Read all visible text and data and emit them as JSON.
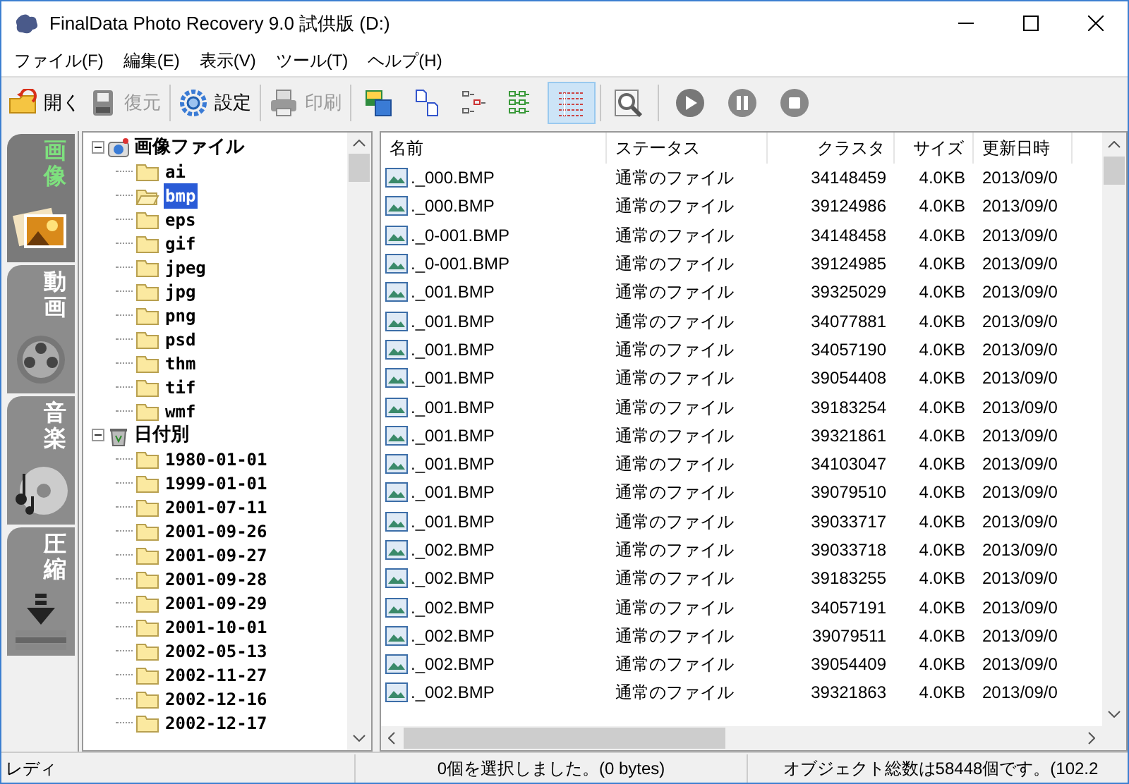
{
  "window": {
    "title": "FinalData Photo Recovery 9.0 試供版 (D:)"
  },
  "menu": [
    "ファイル(F)",
    "編集(E)",
    "表示(V)",
    "ツール(T)",
    "ヘルプ(H)"
  ],
  "toolbar_groups": [
    [
      {
        "kind": "text",
        "label": "開く",
        "disabled": false
      },
      {
        "kind": "text",
        "label": "復元",
        "disabled": true
      }
    ],
    [
      {
        "kind": "text",
        "label": "設定",
        "disabled": false
      }
    ],
    [
      {
        "kind": "text",
        "label": "印刷",
        "disabled": true
      }
    ],
    [
      {
        "kind": "icon",
        "selected": false
      },
      {
        "kind": "icon",
        "selected": false
      },
      {
        "kind": "icon",
        "selected": false
      },
      {
        "kind": "icon",
        "selected": false
      },
      {
        "kind": "icon",
        "selected": true
      }
    ],
    [
      {
        "kind": "icon",
        "selected": false
      }
    ],
    [
      {
        "kind": "media",
        "selected": false
      },
      {
        "kind": "media",
        "selected": false
      },
      {
        "kind": "media",
        "selected": false
      }
    ]
  ],
  "categories": [
    {
      "label": "画像",
      "selected": true
    },
    {
      "label": "動画",
      "selected": false
    },
    {
      "label": "音楽",
      "selected": false
    },
    {
      "label": "圧縮",
      "selected": false
    }
  ],
  "tree": [
    {
      "label": "画像ファイル",
      "kind": "camera",
      "expanded": true,
      "children": [
        {
          "label": "ai",
          "selected": false
        },
        {
          "label": "bmp",
          "selected": true
        },
        {
          "label": "eps",
          "selected": false
        },
        {
          "label": "gif",
          "selected": false
        },
        {
          "label": "jpeg",
          "selected": false
        },
        {
          "label": "jpg",
          "selected": false
        },
        {
          "label": "png",
          "selected": false
        },
        {
          "label": "psd",
          "selected": false
        },
        {
          "label": "thm",
          "selected": false
        },
        {
          "label": "tif",
          "selected": false
        },
        {
          "label": "wmf",
          "selected": false
        }
      ]
    },
    {
      "label": "日付別",
      "kind": "bin",
      "expanded": true,
      "children": [
        {
          "label": "1980-01-01",
          "selected": false
        },
        {
          "label": "1999-01-01",
          "selected": false
        },
        {
          "label": "2001-07-11",
          "selected": false
        },
        {
          "label": "2001-09-26",
          "selected": false
        },
        {
          "label": "2001-09-27",
          "selected": false
        },
        {
          "label": "2001-09-28",
          "selected": false
        },
        {
          "label": "2001-09-29",
          "selected": false
        },
        {
          "label": "2001-10-01",
          "selected": false
        },
        {
          "label": "2002-05-13",
          "selected": false
        },
        {
          "label": "2002-11-27",
          "selected": false
        },
        {
          "label": "2002-12-16",
          "selected": false
        },
        {
          "label": "2002-12-17",
          "selected": false
        }
      ]
    }
  ],
  "table": {
    "columns": [
      "名前",
      "ステータス",
      "クラスタ",
      "サイズ",
      "更新日時"
    ],
    "rows": [
      [
        "._000.BMP",
        "通常のファイル",
        "34148459",
        "4.0KB",
        "2013/09/0"
      ],
      [
        "._000.BMP",
        "通常のファイル",
        "39124986",
        "4.0KB",
        "2013/09/0"
      ],
      [
        "._0-001.BMP",
        "通常のファイル",
        "34148458",
        "4.0KB",
        "2013/09/0"
      ],
      [
        "._0-001.BMP",
        "通常のファイル",
        "39124985",
        "4.0KB",
        "2013/09/0"
      ],
      [
        "._001.BMP",
        "通常のファイル",
        "39325029",
        "4.0KB",
        "2013/09/0"
      ],
      [
        "._001.BMP",
        "通常のファイル",
        "34077881",
        "4.0KB",
        "2013/09/0"
      ],
      [
        "._001.BMP",
        "通常のファイル",
        "34057190",
        "4.0KB",
        "2013/09/0"
      ],
      [
        "._001.BMP",
        "通常のファイル",
        "39054408",
        "4.0KB",
        "2013/09/0"
      ],
      [
        "._001.BMP",
        "通常のファイル",
        "39183254",
        "4.0KB",
        "2013/09/0"
      ],
      [
        "._001.BMP",
        "通常のファイル",
        "39321861",
        "4.0KB",
        "2013/09/0"
      ],
      [
        "._001.BMP",
        "通常のファイル",
        "34103047",
        "4.0KB",
        "2013/09/0"
      ],
      [
        "._001.BMP",
        "通常のファイル",
        "39079510",
        "4.0KB",
        "2013/09/0"
      ],
      [
        "._001.BMP",
        "通常のファイル",
        "39033717",
        "4.0KB",
        "2013/09/0"
      ],
      [
        "._002.BMP",
        "通常のファイル",
        "39033718",
        "4.0KB",
        "2013/09/0"
      ],
      [
        "._002.BMP",
        "通常のファイル",
        "39183255",
        "4.0KB",
        "2013/09/0"
      ],
      [
        "._002.BMP",
        "通常のファイル",
        "34057191",
        "4.0KB",
        "2013/09/0"
      ],
      [
        "._002.BMP",
        "通常のファイル",
        "39079511",
        "4.0KB",
        "2013/09/0"
      ],
      [
        "._002.BMP",
        "通常のファイル",
        "39054409",
        "4.0KB",
        "2013/09/0"
      ],
      [
        "._002.BMP",
        "通常のファイル",
        "39321863",
        "4.0KB",
        "2013/09/0"
      ]
    ]
  },
  "status_bar": [
    "レディ",
    "0個を選択しました。(0 bytes)",
    "オブジェクト総数は58448個です。(102.2"
  ]
}
